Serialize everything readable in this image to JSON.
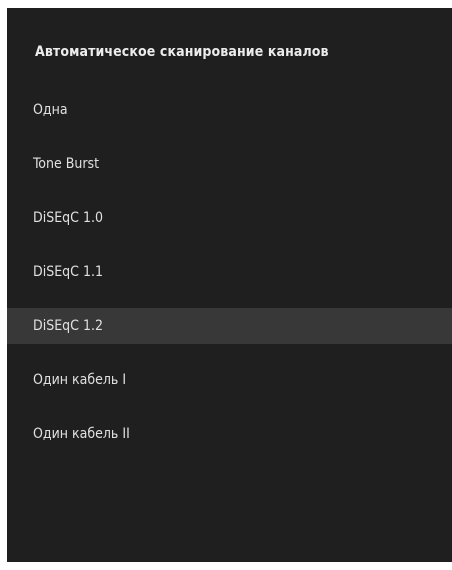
{
  "title": "Автоматическое сканирование каналов",
  "options": [
    {
      "label": "Одна"
    },
    {
      "label": "Tone Burst"
    },
    {
      "label": "DiSEqC 1.0"
    },
    {
      "label": "DiSEqC 1.1"
    },
    {
      "label": "DiSEqC 1.2"
    },
    {
      "label": "Один кабель I"
    },
    {
      "label": "Один кабель II"
    }
  ],
  "selected_label": "DiSEqC 1.2",
  "colors": {
    "panel_background": "#1f1f1f",
    "selected_row": "#383838",
    "text": "#e0e0e0"
  }
}
